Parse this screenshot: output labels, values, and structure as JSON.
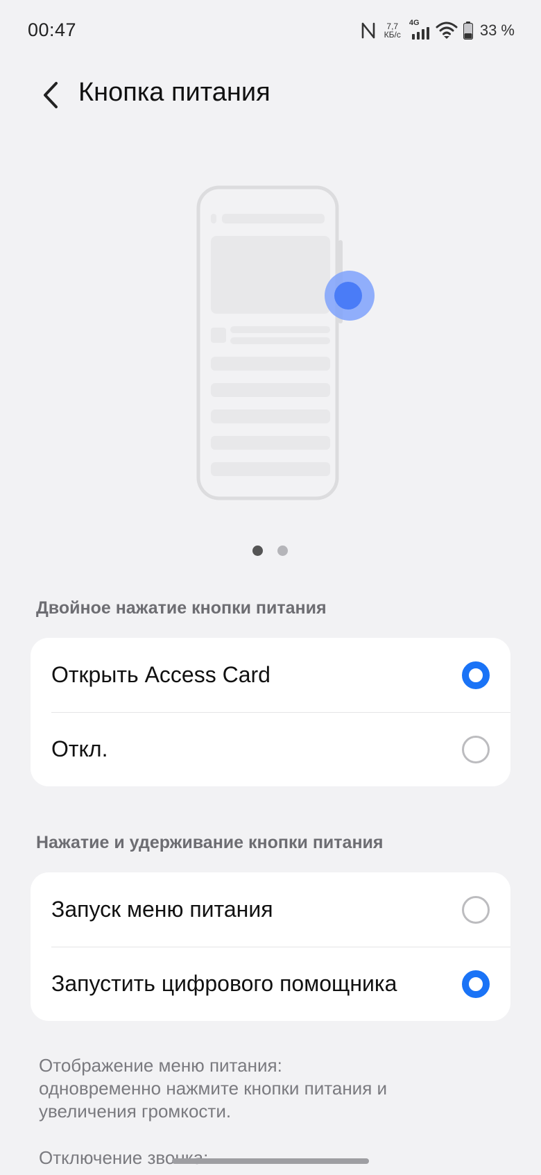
{
  "status_bar": {
    "time": "00:47",
    "speed_value": "7,7",
    "speed_unit": "КБ/с",
    "network": "4G",
    "battery": "33 %",
    "icons": [
      "nfc-icon",
      "signal-icon",
      "wifi-icon",
      "battery-icon"
    ]
  },
  "header": {
    "back_icon": "chevron-left-icon",
    "title": "Кнопка питания"
  },
  "illustration": {
    "page_indicator": {
      "count": 2,
      "active": 1
    },
    "accent_color": "#4a7cf7"
  },
  "double_press": {
    "title": "Двойное нажатие кнопки питания",
    "options": [
      {
        "label": "Открыть Access Card",
        "selected": true
      },
      {
        "label": "Откл.",
        "selected": false
      }
    ]
  },
  "press_hold": {
    "title": "Нажатие и удерживание кнопки питания",
    "options": [
      {
        "label": "Запуск меню питания",
        "selected": false
      },
      {
        "label": "Запустить цифрового помощника",
        "selected": true
      }
    ]
  },
  "footer": {
    "power_menu_info_line1": "Отображение меню питания:",
    "power_menu_info_line2": "одновременно нажмите кнопки питания и",
    "power_menu_info_line3": "увеличения громкости.",
    "mute_info": "Отключение звонка:"
  },
  "colors": {
    "background": "#f2f2f4",
    "accent": "#1a73f6",
    "section_title": "#6d6d72"
  }
}
